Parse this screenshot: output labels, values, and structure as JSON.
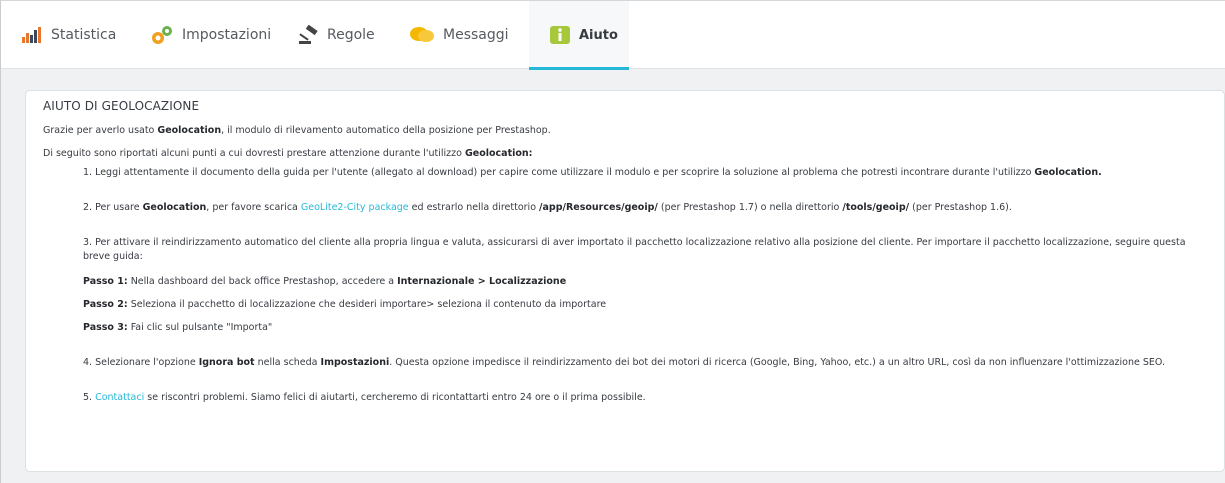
{
  "tabs": [
    {
      "label": "Statistica",
      "icon": "bar-chart-icon"
    },
    {
      "label": "Impostazioni",
      "icon": "gears-icon"
    },
    {
      "label": "Regole",
      "icon": "gavel-icon"
    },
    {
      "label": "Messaggi",
      "icon": "chat-bubbles-icon"
    },
    {
      "label": "Aiuto",
      "icon": "info-icon",
      "active": true
    }
  ],
  "colors": {
    "accent": "#25b9d7",
    "text": "#363a41",
    "background": "#eff1f2"
  },
  "help": {
    "title": "AIUTO DI GEOLOCAZIONE",
    "intro1": {
      "pre": "Grazie per averlo usato ",
      "bold": "Geolocation",
      "post": ", il modulo di rilevamento automatico della posizione per Prestashop."
    },
    "intro2": {
      "pre": "Di seguito sono riportati alcuni punti a cui dovresti prestare attenzione durante l'utilizzo ",
      "bold": "Geolocation:"
    },
    "item1": {
      "pre": "1. Leggi attentamente il documento della guida per l'utente (allegato al download) per capire come utilizzare il modulo e per scoprire la soluzione al problema che potresti incontrare durante l'utilizzo ",
      "bold": "Geolocation."
    },
    "item2": {
      "pre": "2. Per usare ",
      "bold1": "Geolocation",
      "mid1": ", per favore scarica ",
      "link": "GeoLite2-City package",
      "mid2": " ed estrarlo nella direttorio ",
      "path1": "/app/Resources/geoip/",
      "mid3": " (per Prestashop 1.7) o nella direttorio ",
      "path2": "/tools/geoip/",
      "post": " (per Prestashop 1.6)."
    },
    "item3": {
      "text": "3. Per attivare il reindirizzamento automatico del cliente alla propria lingua e valuta, assicurarsi di aver importato il pacchetto localizzazione relativo alla posizione del cliente. Per importare il pacchetto localizzazione, seguire questa breve guida:"
    },
    "steps": [
      {
        "label": "Passo 1:",
        "text": " Nella dashboard del back office Prestashop, accedere a ",
        "bold": "Internazionale > Localizzazione"
      },
      {
        "label": "Passo 2:",
        "text": " Seleziona il pacchetto di localizzazione che desideri importare> seleziona il contenuto da importare",
        "bold": ""
      },
      {
        "label": "Passo 3:",
        "text": " Fai clic sul pulsante \"Importa\"",
        "bold": ""
      }
    ],
    "item4": {
      "pre": "4. Selezionare l'opzione ",
      "bold1": "Ignora bot",
      "mid": " nella scheda ",
      "bold2": "Impostazioni",
      "post": ". Questa opzione impedisce il reindirizzamento dei bot dei motori di ricerca (Google, Bing, Yahoo, etc.) a un altro URL, così da non influenzare l'ottimizzazione SEO."
    },
    "item5": {
      "pre": "5. ",
      "link": "Contattaci",
      "post": " se riscontri problemi. Siamo felici di aiutarti, cercheremo di ricontattarti entro 24 ore o il prima possibile."
    }
  }
}
